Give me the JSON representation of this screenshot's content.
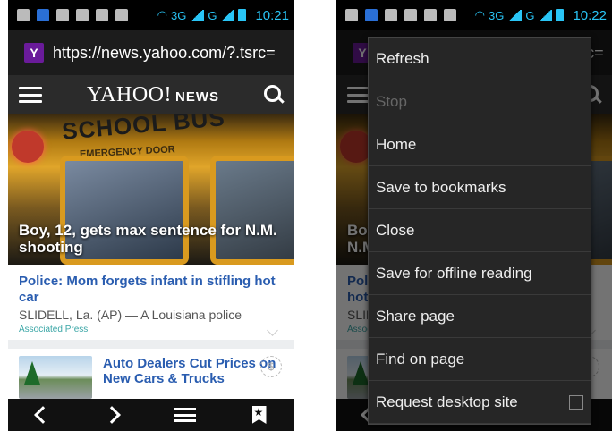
{
  "status": {
    "network": "3G",
    "network2": "G",
    "time_left": "10:21",
    "time_right": "10:22"
  },
  "browser": {
    "url": "https://news.yahoo.com/?.tsrc="
  },
  "yahoo": {
    "brand": "YAHOO!",
    "section": "NEWS"
  },
  "hero": {
    "sign": "SCHOOL BUS",
    "door": "EMERGENCY DOOR",
    "caption": "Boy, 12, gets max sentence for N.M. shooting"
  },
  "story": {
    "headline": "Police: Mom forgets infant in stifling hot car",
    "body": "SLIDELL, La. (AP) — A Louisiana police",
    "source": "Associated Press"
  },
  "ad": {
    "headline": "Auto Dealers Cut Prices on New Cars & Trucks",
    "badge": "$"
  },
  "menu": {
    "items": [
      {
        "label": "Refresh"
      },
      {
        "label": "Stop"
      },
      {
        "label": "Home"
      },
      {
        "label": "Save to bookmarks"
      },
      {
        "label": "Close"
      },
      {
        "label": "Save for offline reading"
      },
      {
        "label": "Share page"
      },
      {
        "label": "Find on page"
      },
      {
        "label": "Request desktop site"
      }
    ]
  }
}
